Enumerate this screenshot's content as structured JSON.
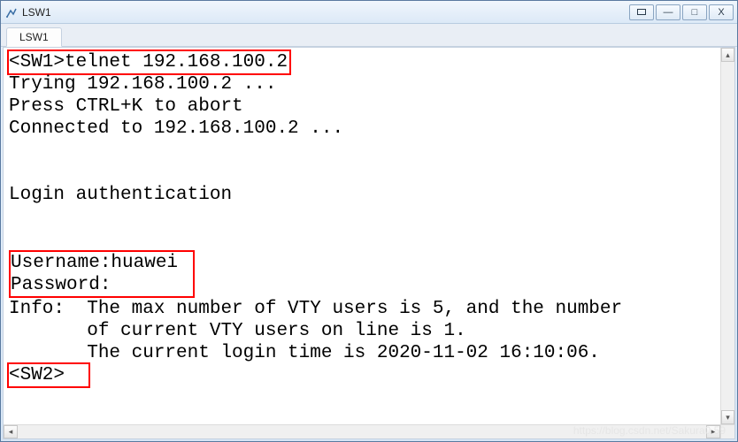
{
  "window": {
    "title": "LSW1"
  },
  "tab": {
    "label": "LSW1"
  },
  "console": {
    "line1_prompt": "<SW1>",
    "line1_cmd": "telnet 192.168.100.2",
    "line2": "Trying 192.168.100.2 ...",
    "line3": "Press CTRL+K to abort",
    "line4": "Connected to 192.168.100.2 ...",
    "line5": "Login authentication",
    "line6": "Username:huawei",
    "line7": "Password:",
    "line8": "Info:  The max number of VTY users is 5, and the number",
    "line9": "       of current VTY users on line is 1.",
    "line10": "       The current login time is 2020-11-02 16:10:06.",
    "line11_prompt": "<SW2>"
  },
  "watermark": "https://blog.csdn.net/Sakura0.59"
}
